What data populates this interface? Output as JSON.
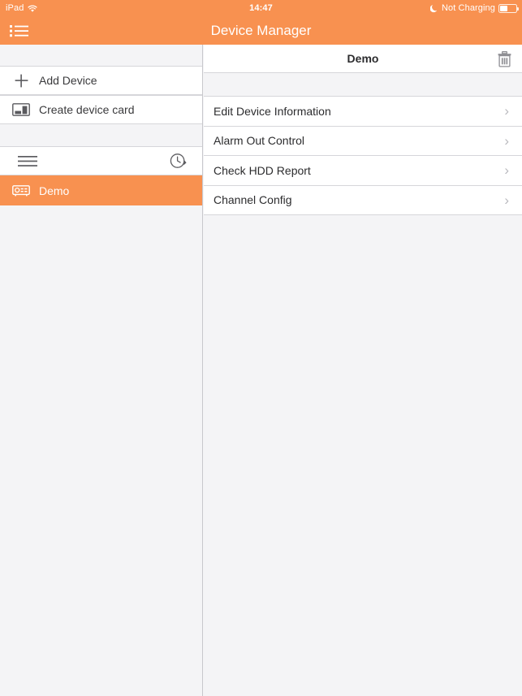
{
  "status_bar": {
    "device_label": "iPad",
    "wifi_icon": "wifi-icon",
    "time": "14:47",
    "charging_status": "Not Charging",
    "moon_icon": "moon-icon",
    "battery_icon": "battery-icon"
  },
  "nav_bar": {
    "title": "Device Manager",
    "menu_icon": "bulleted-list-icon",
    "background_color": "#f89150"
  },
  "sidebar": {
    "items": [
      {
        "label": "Add Device",
        "icon": "plus-icon"
      },
      {
        "label": "Create device card",
        "icon": "device-card-icon"
      }
    ],
    "toolbar": {
      "menu_icon": "hamburger-icon",
      "history_icon": "clock-history-icon"
    },
    "devices": [
      {
        "label": "Demo",
        "icon": "dvr-device-icon",
        "selected": true
      }
    ]
  },
  "detail": {
    "header": {
      "title": "Demo",
      "delete_icon": "trash-icon"
    },
    "menu_items": [
      {
        "label": "Edit Device Information",
        "chevron": "›"
      },
      {
        "label": "Alarm Out Control",
        "chevron": "›"
      },
      {
        "label": "Check HDD Report",
        "chevron": "›"
      },
      {
        "label": "Channel Config",
        "chevron": "›"
      }
    ]
  },
  "colors": {
    "accent": "#f89150",
    "background": "#f4f4f6",
    "row_background": "#ffffff",
    "separator": "#d6d6da",
    "text_primary": "#2c2c2e",
    "chevron": "#b9b9be"
  }
}
